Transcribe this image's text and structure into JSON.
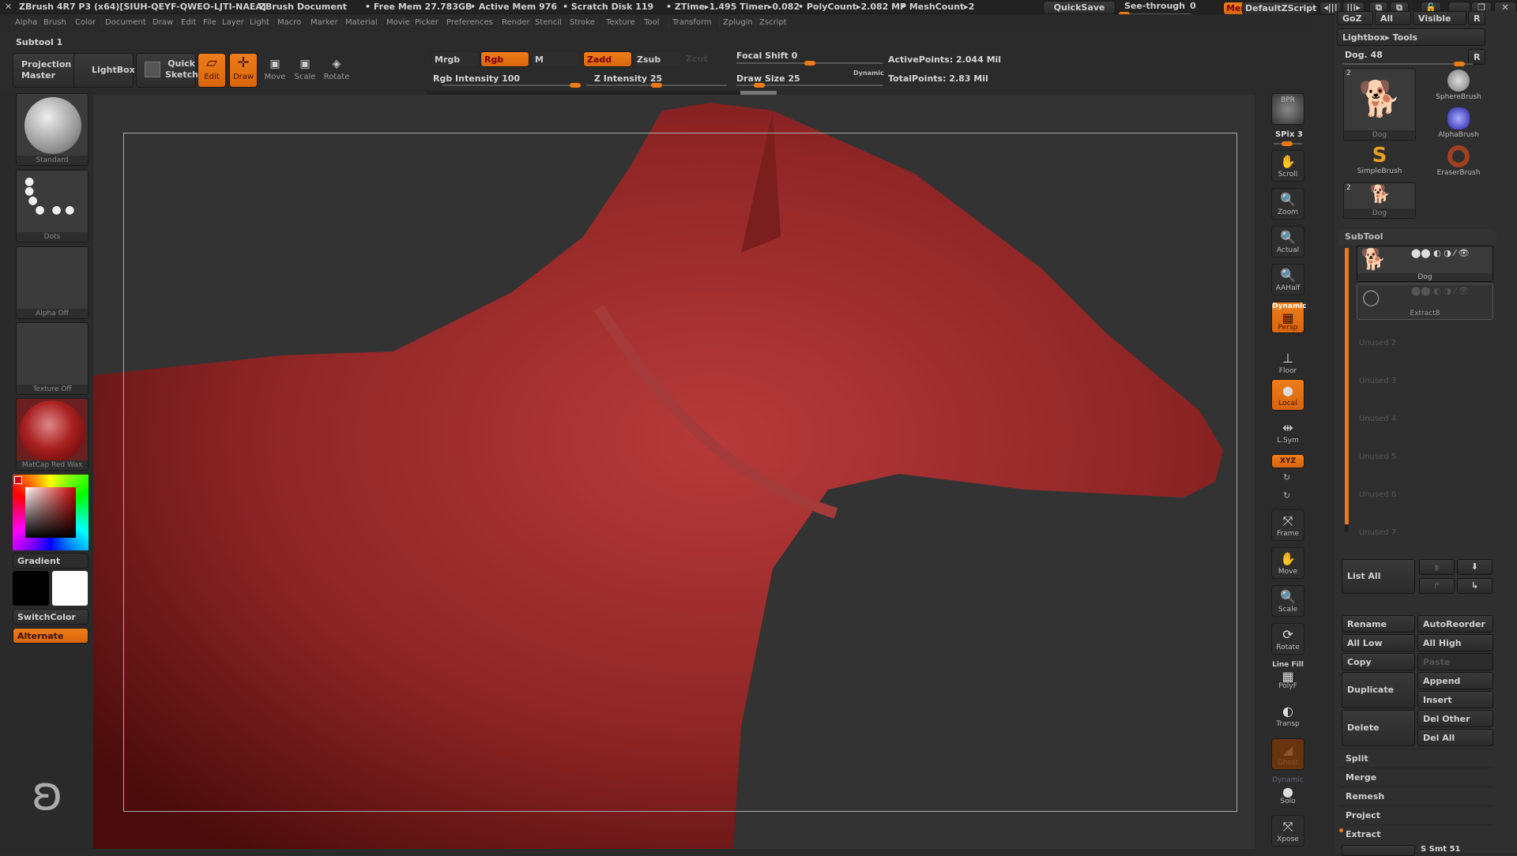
{
  "titlebar": {
    "app": "ZBrush 4R7 P3 (x64)[SIUH-QEYF-QWEO-LJTI-NAEA]",
    "document": "ZBrush Document",
    "free_mem": "• Free Mem 27.783GB",
    "active_mem": "• Active Mem 976",
    "scratch_disk": "• Scratch Disk 119",
    "ztime": "• ZTime▸1.495 Timer▸0.082",
    "polycount": "• PolyCount▸2.082 MP",
    "meshcount": "• MeshCount▸2",
    "quicksave": "QuickSave",
    "see_through_label": "See-through",
    "see_through_value": "0",
    "menus": "Menus",
    "script": "DefaultZScript"
  },
  "menubar": [
    "Alpha",
    "Brush",
    "Color",
    "Document",
    "Draw",
    "Edit",
    "File",
    "Layer",
    "Light",
    "Macro",
    "Marker",
    "Material",
    "Movie",
    "Picker",
    "Preferences",
    "Render",
    "Stencil",
    "Stroke",
    "Texture",
    "Tool",
    "Transform",
    "Zplugin",
    "Zscript"
  ],
  "toolbar": {
    "subtool_label": "Subtool 1",
    "projection_master": "Projection Master",
    "lightbox": "LightBox",
    "quick_sketch": "Quick Sketch",
    "edit": "Edit",
    "draw": "Draw",
    "move": "Move",
    "scale": "Scale",
    "rotate": "Rotate",
    "mrgb": "Mrgb",
    "rgb": "Rgb",
    "m": "M",
    "zadd": "Zadd",
    "zsub": "Zsub",
    "zcut": "Zcut",
    "rgb_intensity": "Rgb Intensity 100",
    "rgb_intensity_value": 100,
    "z_intensity": "Z Intensity 25",
    "z_intensity_value": 25,
    "focal_shift": "Focal Shift 0",
    "focal_shift_value": 0,
    "draw_size": "Draw Size 25",
    "draw_size_value": 25,
    "dynamic": "Dynamic",
    "active_points": "ActivePoints: 2.044 Mil",
    "total_points": "TotalPoints: 2.83 Mil"
  },
  "leftpanel": {
    "brush": "Standard",
    "stroke": "Dots",
    "alpha": "Alpha Off",
    "texture": "Texture Off",
    "material": "MatCap Red Wax",
    "gradient": "Gradient",
    "switchcolor": "SwitchColor",
    "alternate": "Alternate",
    "main_color": "#000000",
    "secondary_color": "#ffffff",
    "accent": "#ef7a12"
  },
  "shelf": [
    {
      "icon": "bpr-icon",
      "label": "BPR"
    },
    {
      "label": "SPix 3"
    },
    {
      "icon": "scroll-icon",
      "label": "Scroll"
    },
    {
      "icon": "zoom-icon",
      "label": "Zoom"
    },
    {
      "icon": "actual-icon",
      "label": "Actual"
    },
    {
      "icon": "aahalf-icon",
      "label": "AAHalf"
    },
    {
      "icon": "persp-icon",
      "label": "Persp",
      "top": "Dynamic"
    },
    {
      "icon": "floor-icon",
      "label": "Floor"
    },
    {
      "icon": "local-icon",
      "label": "Local"
    },
    {
      "icon": "lsym-icon",
      "label": "L.Sym"
    },
    {
      "icon": "xyz-icon",
      "label": "XYZ"
    },
    {
      "icon": "frame-icon",
      "label": "Frame"
    },
    {
      "icon": "move-icon",
      "label": "Move"
    },
    {
      "icon": "scale-icon",
      "label": "Scale"
    },
    {
      "icon": "rotate-icon",
      "label": "Rotate"
    },
    {
      "icon": "polyf-icon",
      "label": "PolyF",
      "top": "Line Fill"
    },
    {
      "icon": "transp-icon",
      "label": "Transp"
    },
    {
      "icon": "ghost-icon",
      "label": "Ghost"
    },
    {
      "icon": "solo-icon",
      "label": "Solo",
      "top": "Dynamic"
    },
    {
      "icon": "xpose-icon",
      "label": "Xpose"
    }
  ],
  "rightpanel": {
    "goz": "GoZ",
    "all": "All",
    "visible": "Visible",
    "r": "R",
    "lightbox_tools": "Lightbox▸ Tools",
    "tool_name": "Dog. 48",
    "tools": [
      {
        "name": "Dog",
        "count": "2"
      },
      {
        "name": "SphereBrush"
      },
      {
        "name": "AlphaBrush"
      },
      {
        "name": "SimpleBrush"
      },
      {
        "name": "EraserBrush"
      },
      {
        "name": "Dog",
        "count": "2"
      }
    ],
    "subtool_header": "SubTool",
    "subtools": [
      "Dog",
      "Extract8"
    ],
    "unused": [
      "Unused 2",
      "Unused 3",
      "Unused 4",
      "Unused 5",
      "Unused 6",
      "Unused 7"
    ],
    "list_all": "List All",
    "buttons": {
      "rename": "Rename",
      "autoreorder": "AutoReorder",
      "all_low": "All Low",
      "all_high": "All High",
      "copy": "Copy",
      "paste": "Paste",
      "duplicate": "Duplicate",
      "append": "Append",
      "insert": "Insert",
      "delete": "Delete",
      "del_other": "Del Other",
      "del_all": "Del All"
    },
    "sections": [
      "Split",
      "Merge",
      "Remesh",
      "Project",
      "Extract"
    ],
    "s_smt": "S Smt 51"
  }
}
